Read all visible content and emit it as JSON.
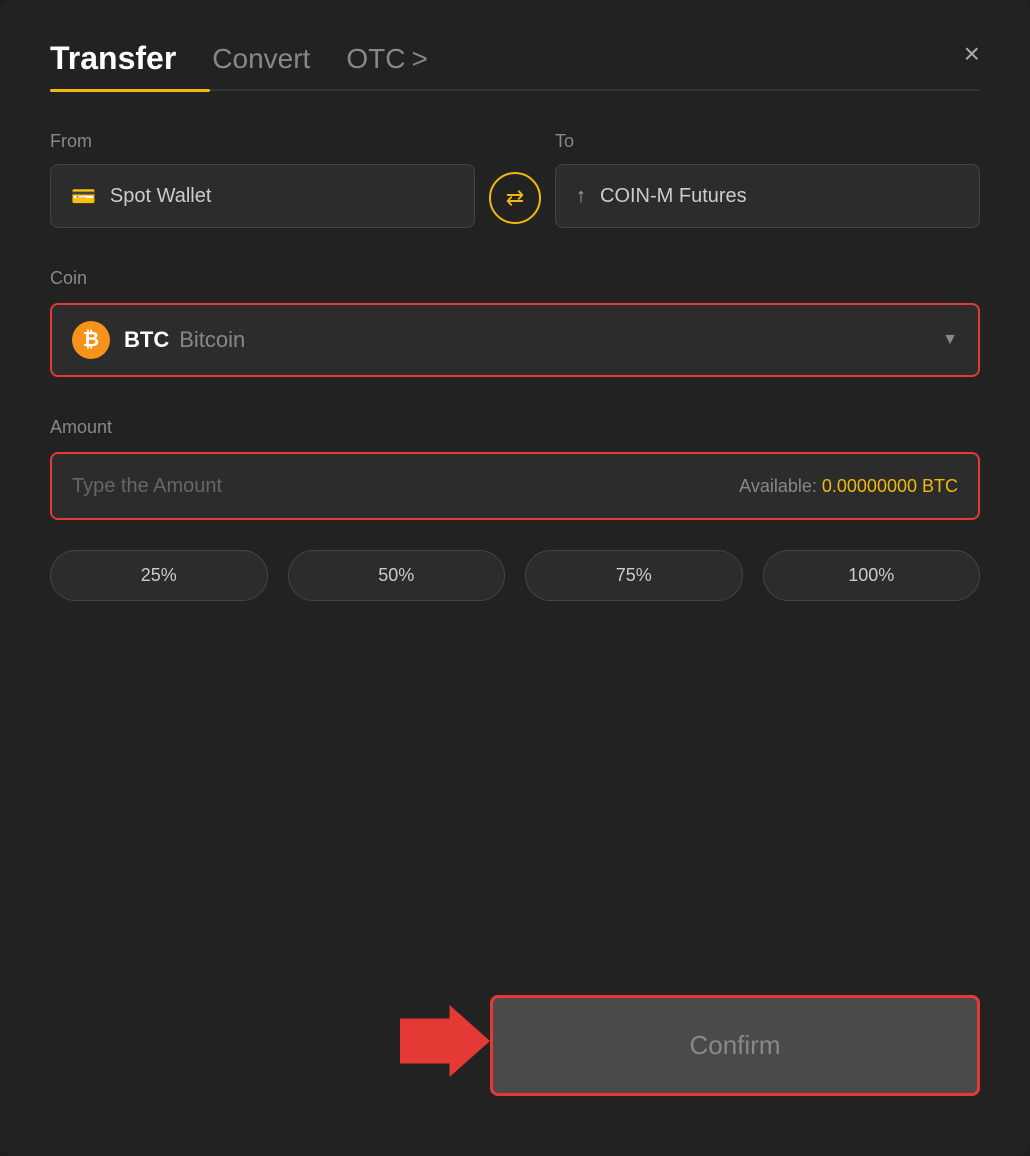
{
  "header": {
    "tab_transfer": "Transfer",
    "tab_convert": "Convert",
    "tab_otc": "OTC",
    "tab_otc_arrow": ">",
    "close_label": "×"
  },
  "from_field": {
    "label": "From",
    "value": "Spot Wallet",
    "icon": "💳"
  },
  "to_field": {
    "label": "To",
    "value": "COIN-M Futures",
    "icon": "↑"
  },
  "swap_icon": "⇄",
  "coin_section": {
    "label": "Coin",
    "symbol": "BTC",
    "name": "Bitcoin"
  },
  "amount_section": {
    "label": "Amount",
    "placeholder": "Type the Amount",
    "available_label": "Available:",
    "available_value": "0.00000000 BTC"
  },
  "percent_buttons": [
    "25%",
    "50%",
    "75%",
    "100%"
  ],
  "confirm_button": "Confirm"
}
